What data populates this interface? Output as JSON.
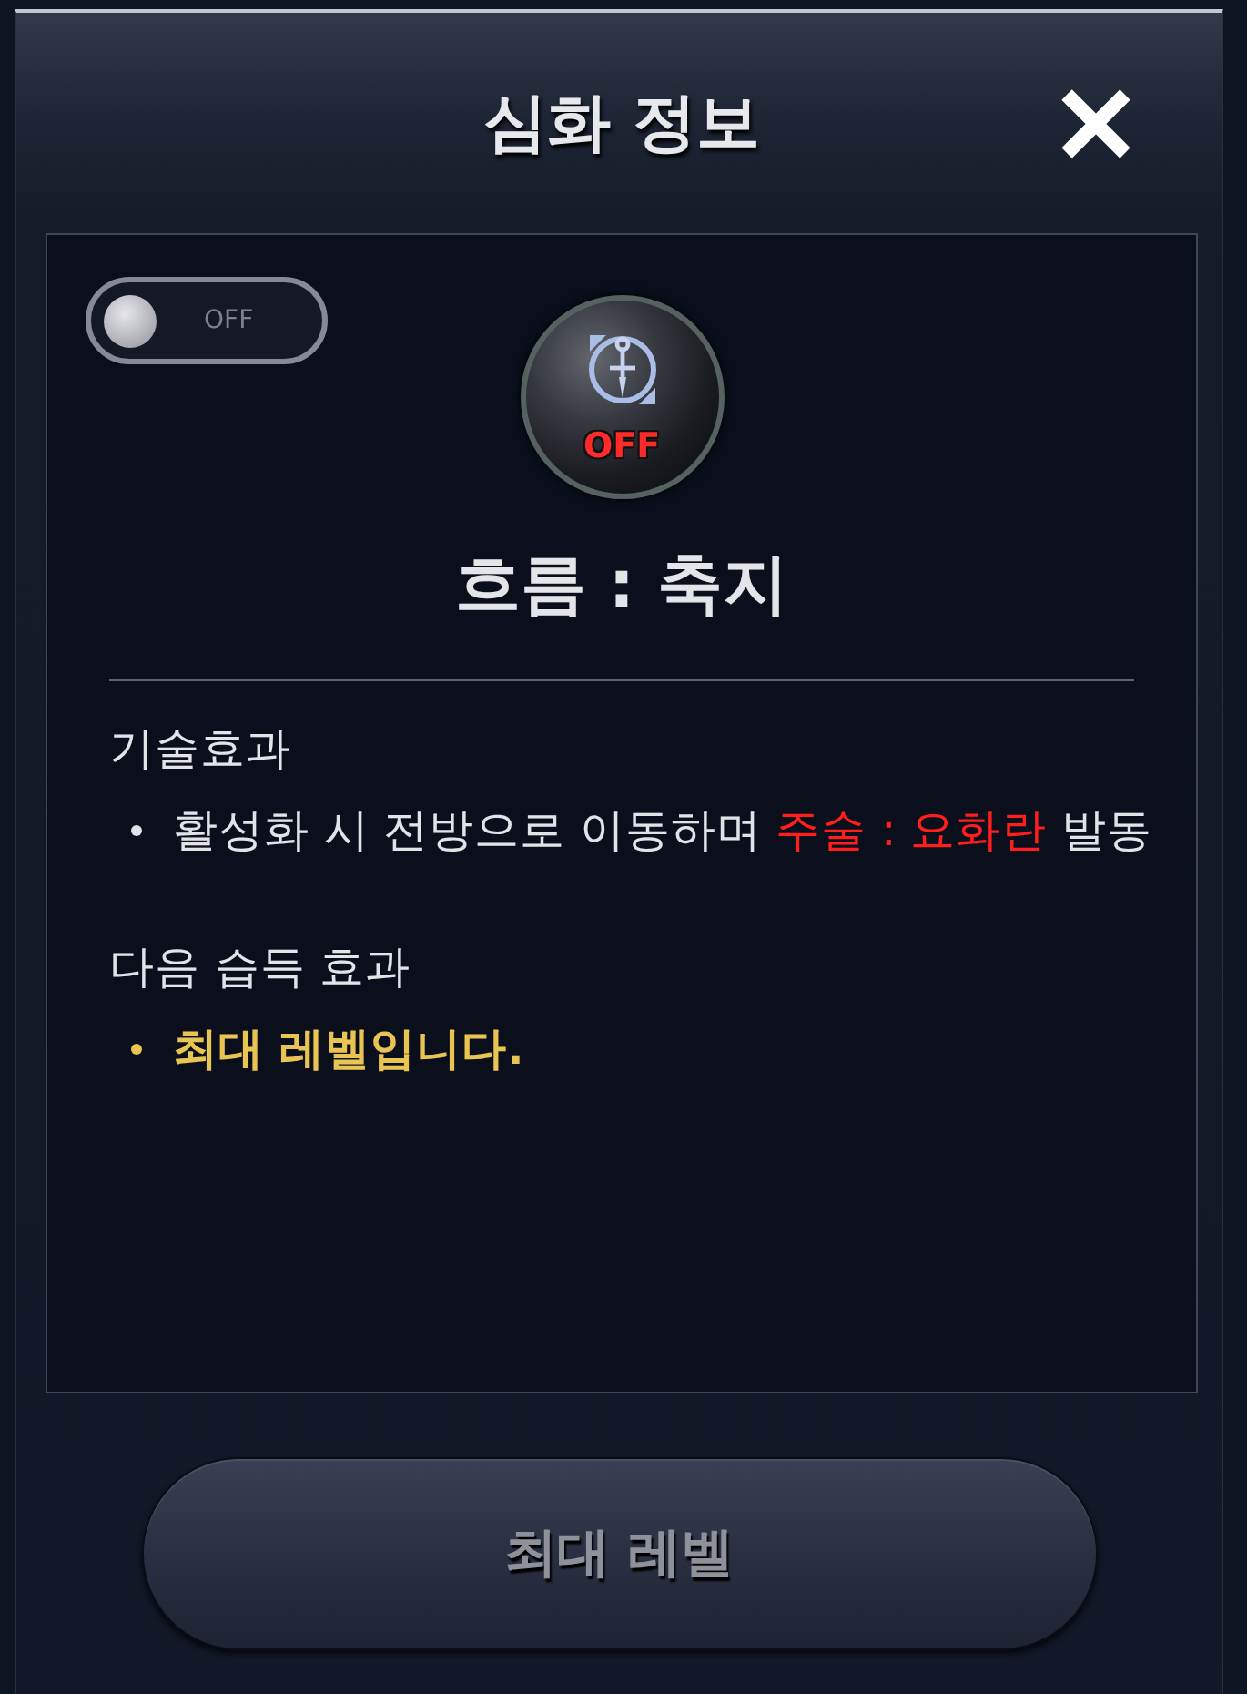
{
  "dialog": {
    "title": "심화 정보"
  },
  "toggle": {
    "label": "OFF",
    "on": false
  },
  "skill": {
    "status": "OFF",
    "active": false,
    "name": "흐름 : 축지"
  },
  "sections": [
    {
      "heading": "기술효과",
      "items": [
        {
          "kind": "effect",
          "parts": [
            {
              "text": "활성화 시 전방으로 이동하며 ",
              "highlight": false
            },
            {
              "text": "주술 : 요화란",
              "highlight": true
            },
            {
              "text": " 발동",
              "highlight": false
            }
          ]
        }
      ]
    },
    {
      "heading": "다음 습득 효과",
      "items": [
        {
          "kind": "notice",
          "parts": [
            {
              "text": "최대 레벨입니다.",
              "highlight": false
            }
          ]
        }
      ]
    }
  ],
  "action_button": {
    "label": "최대 레벨",
    "disabled": true
  }
}
